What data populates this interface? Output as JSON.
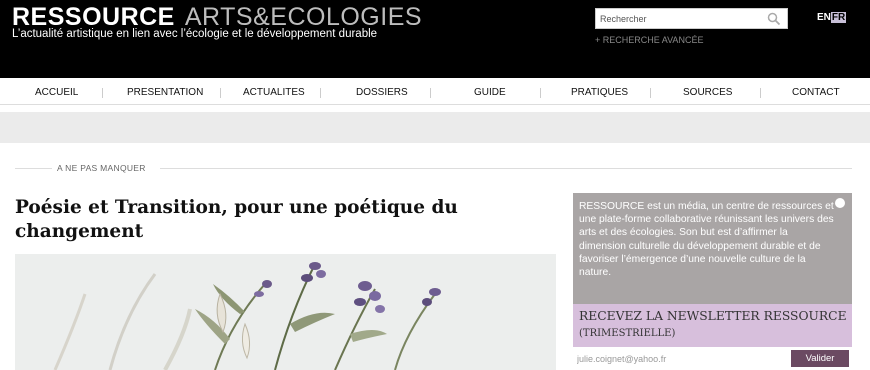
{
  "header": {
    "brand_main": "RESSOURCE",
    "brand_sub": "ARTS&ECOLOGIES",
    "tagline": "L’actualité artistique en lien avec l’écologie et le développement durable",
    "search_placeholder": "Rechercher",
    "advanced_search": "+ RECHERCHE AVANCÉE",
    "lang_en": "EN",
    "lang_fr": "FR"
  },
  "nav": {
    "items": [
      {
        "label": "ACCUEIL"
      },
      {
        "label": "PRESENTATION"
      },
      {
        "label": "ACTUALITES"
      },
      {
        "label": "DOSSIERS"
      },
      {
        "label": "GUIDE"
      },
      {
        "label": "PRATIQUES"
      },
      {
        "label": "SOURCES"
      },
      {
        "label": "CONTACT"
      }
    ]
  },
  "main": {
    "section_label": "A NE PAS MANQUER",
    "article_title": "Poésie et Transition, pour une poétique du changement"
  },
  "sidebar": {
    "about_text": "RESSOURCE est un média, un centre de ressources et une plate-forme collaborative réunissant les univers des arts et des écologies. Son but est d’affirmer la dimension culturelle du développement durable et de favoriser l’émergence d’une nouvelle culture de la nature.",
    "newsletter_title": "RECEVEZ LA NEWSLETTER RESSOURCE",
    "newsletter_sub": "(TRIMESTRIELLE)",
    "email_value": "julie.coignet@yahoo.fr",
    "validate_label": "Valider"
  },
  "colors": {
    "header_bg": "#000000",
    "sidebar_panel": "#a9a5a5",
    "newsletter_bg": "#d7bfdc",
    "button_bg": "#6b4a62",
    "band_grey": "#ebebeb"
  },
  "icons": {
    "search": "search-icon",
    "dot": "circle-icon"
  }
}
